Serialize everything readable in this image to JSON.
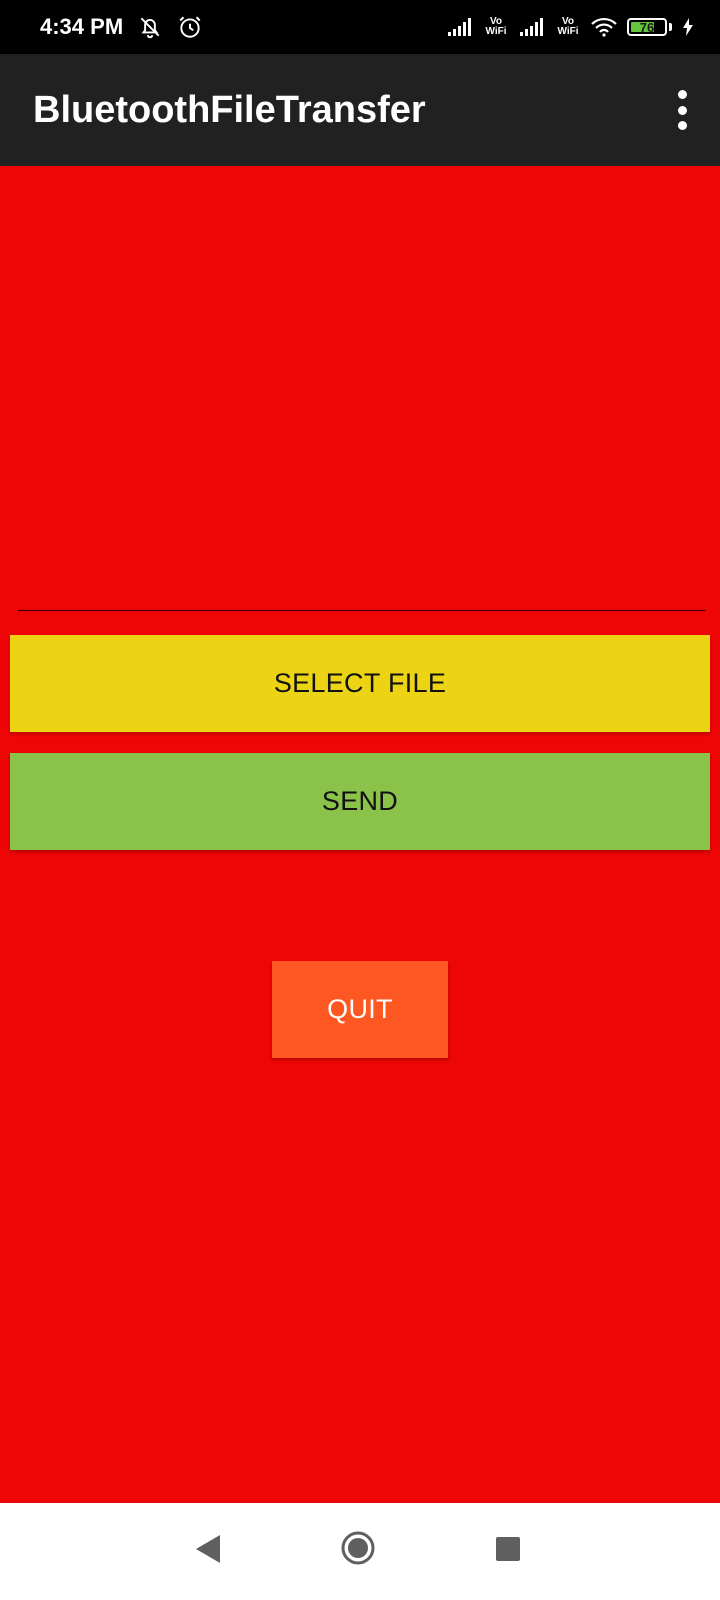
{
  "status_bar": {
    "time": "4:34 PM",
    "icons": [
      "notifications-off-icon",
      "alarm-icon",
      "signal-icon",
      "vowifi-icon",
      "signal-icon",
      "vowifi-icon",
      "wifi-icon",
      "battery-icon",
      "charging-icon"
    ],
    "vowifi_top": "Vo",
    "vowifi_bottom": "WiFi",
    "battery_level": "76",
    "battery_fraction": 0.76
  },
  "app_bar": {
    "title": "BluetoothFileTransfer",
    "overflow_icon": "more-vert-icon"
  },
  "main": {
    "file_path_value": "",
    "select_label": "SELECT FILE",
    "send_label": "SEND",
    "quit_label": "QUIT"
  },
  "nav_bar": {
    "icons": [
      "back-icon",
      "home-icon",
      "recents-icon"
    ]
  },
  "colors": {
    "background": "#ee0505",
    "select_button": "#ecd414",
    "send_button": "#8bc34a",
    "quit_button": "#ff5722",
    "app_bar": "#212121"
  }
}
